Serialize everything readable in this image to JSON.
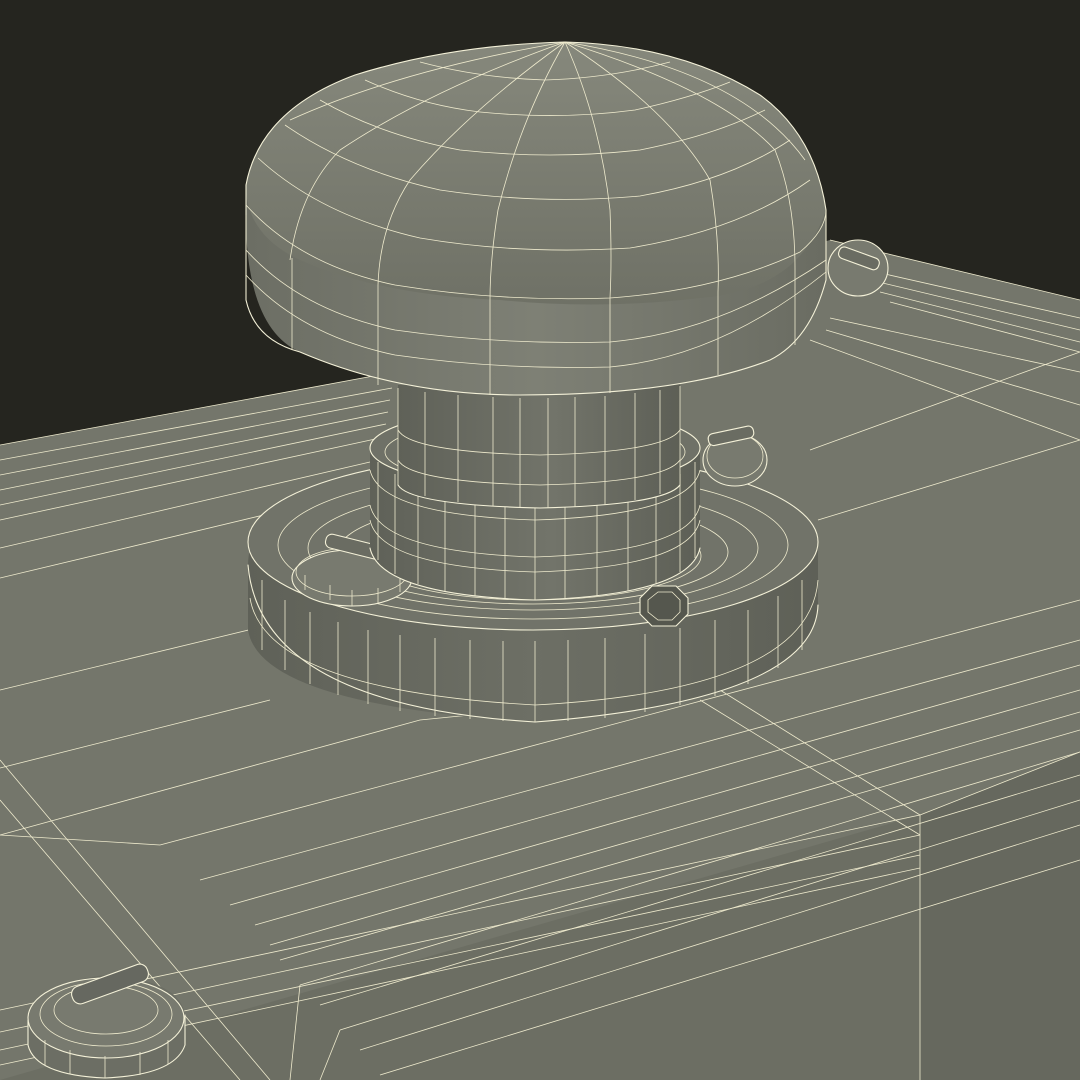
{
  "scene": {
    "background_color": "#25251f",
    "surface_color": "#74766b",
    "wire_color": "#f4f1d8",
    "subject": "mushroom-button-icon"
  }
}
